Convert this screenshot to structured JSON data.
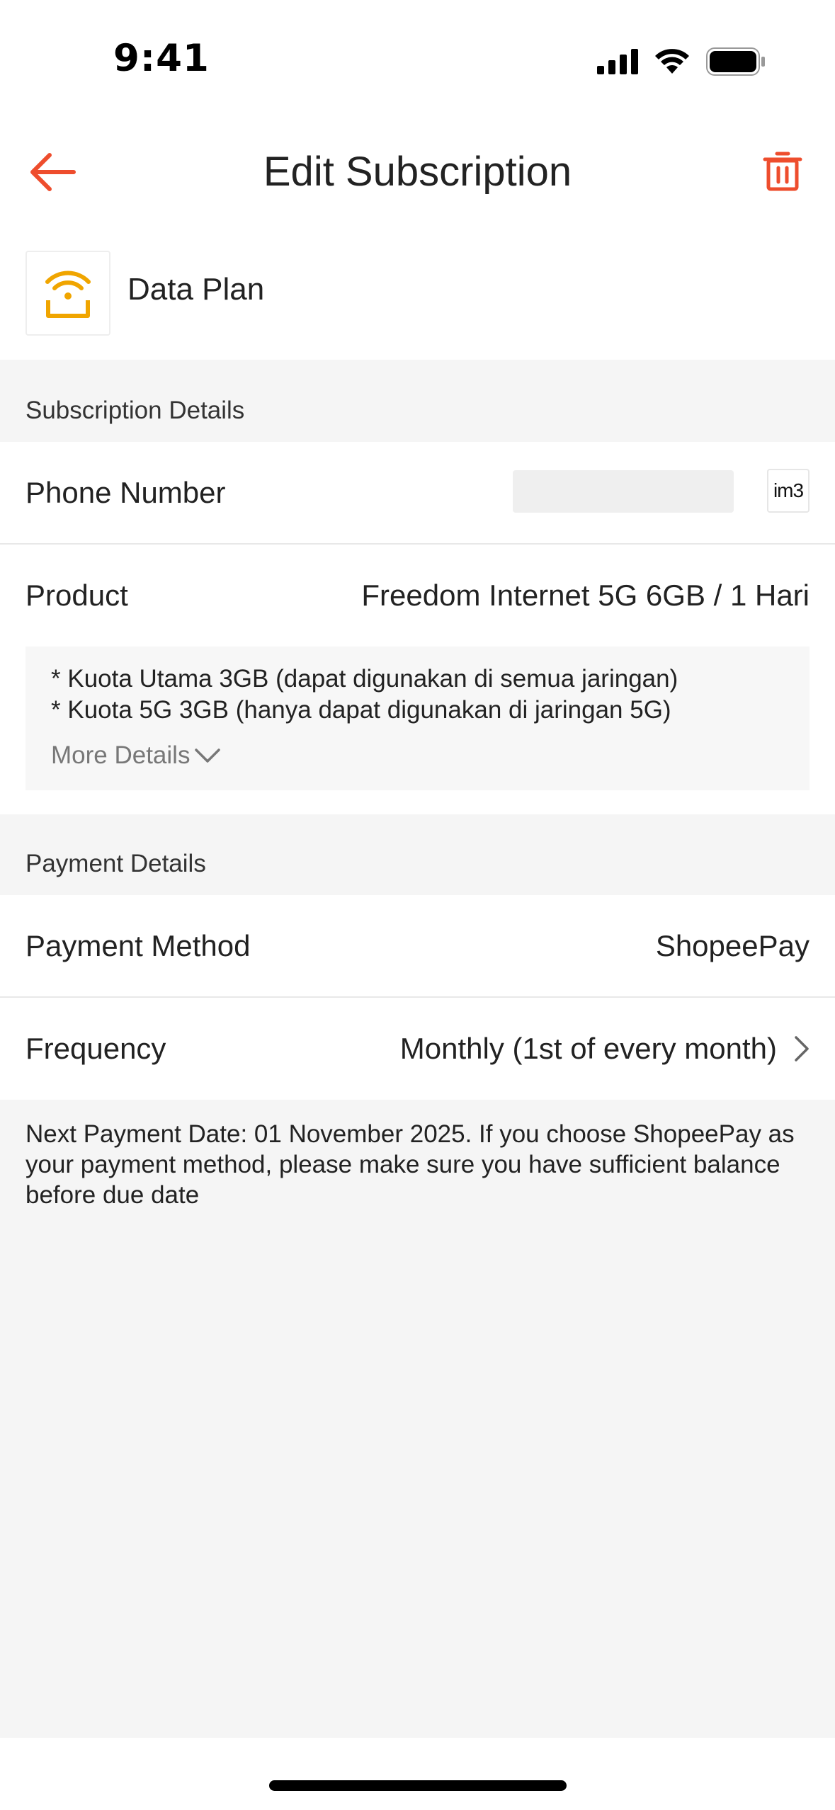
{
  "status_bar": {
    "time": "9:41",
    "icons": [
      "cellular-signal-icon",
      "wifi-icon",
      "battery-icon"
    ]
  },
  "nav": {
    "title": "Edit Subscription",
    "back_icon": "back-arrow-icon",
    "delete_icon": "trash-icon",
    "accent_color": "#ee4d2d"
  },
  "product": {
    "icon": "wifi-router-icon",
    "icon_color": "#f0a500",
    "name": "Data Plan"
  },
  "subscription_details": {
    "section_title": "Subscription Details",
    "phone_number_label": "Phone Number",
    "operator_logo_text": "im3",
    "product_label": "Product",
    "product_value": "Freedom Internet 5G 6GB / 1 Hari",
    "details": [
      "* Kuota Utama 3GB (dapat digunakan di semua jaringan)",
      "* Kuota 5G 3GB (hanya dapat digunakan di jaringan 5G)"
    ],
    "more_details_label": "More Details"
  },
  "payment_details": {
    "section_title": "Payment Details",
    "payment_method_label": "Payment Method",
    "payment_method_value": "ShopeePay",
    "frequency_label": "Frequency",
    "frequency_value": "Monthly (1st of every month)"
  },
  "note": "Next Payment Date: 01 November 2025. If you choose ShopeePay as your payment method, please make sure you have sufficient balance before due date"
}
